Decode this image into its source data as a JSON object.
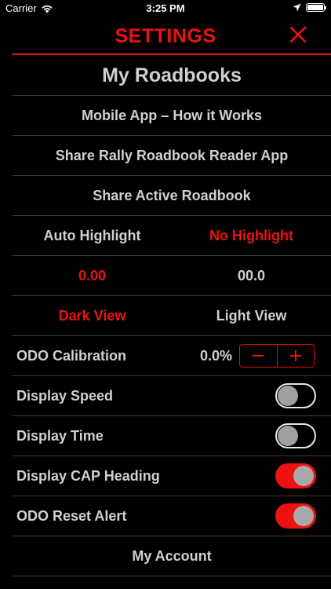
{
  "status_bar": {
    "carrier": "Carrier",
    "time": "3:25 PM"
  },
  "header": {
    "title": "SETTINGS"
  },
  "rows": {
    "my_roadbooks": "My Roadbooks",
    "how_it_works": "Mobile App – How it Works",
    "share_app": "Share Rally Roadbook Reader App",
    "share_roadbook": "Share Active Roadbook",
    "auto_highlight": "Auto Highlight",
    "no_highlight": "No Highlight",
    "format_a": "0.00",
    "format_b": "00.0",
    "dark_view": "Dark View",
    "light_view": "Light View",
    "odo_calibration": "ODO Calibration",
    "odo_value": "0.0%",
    "display_speed": "Display Speed",
    "display_time": "Display Time",
    "display_cap": "Display CAP Heading",
    "odo_reset": "ODO Reset Alert",
    "my_account": "My Account"
  },
  "toggles": {
    "display_speed": false,
    "display_time": false,
    "display_cap": true,
    "odo_reset": true
  },
  "colors": {
    "accent": "#ee1111",
    "background": "#000000",
    "text": "#d0d0d0",
    "divider": "#3a3a3a"
  }
}
